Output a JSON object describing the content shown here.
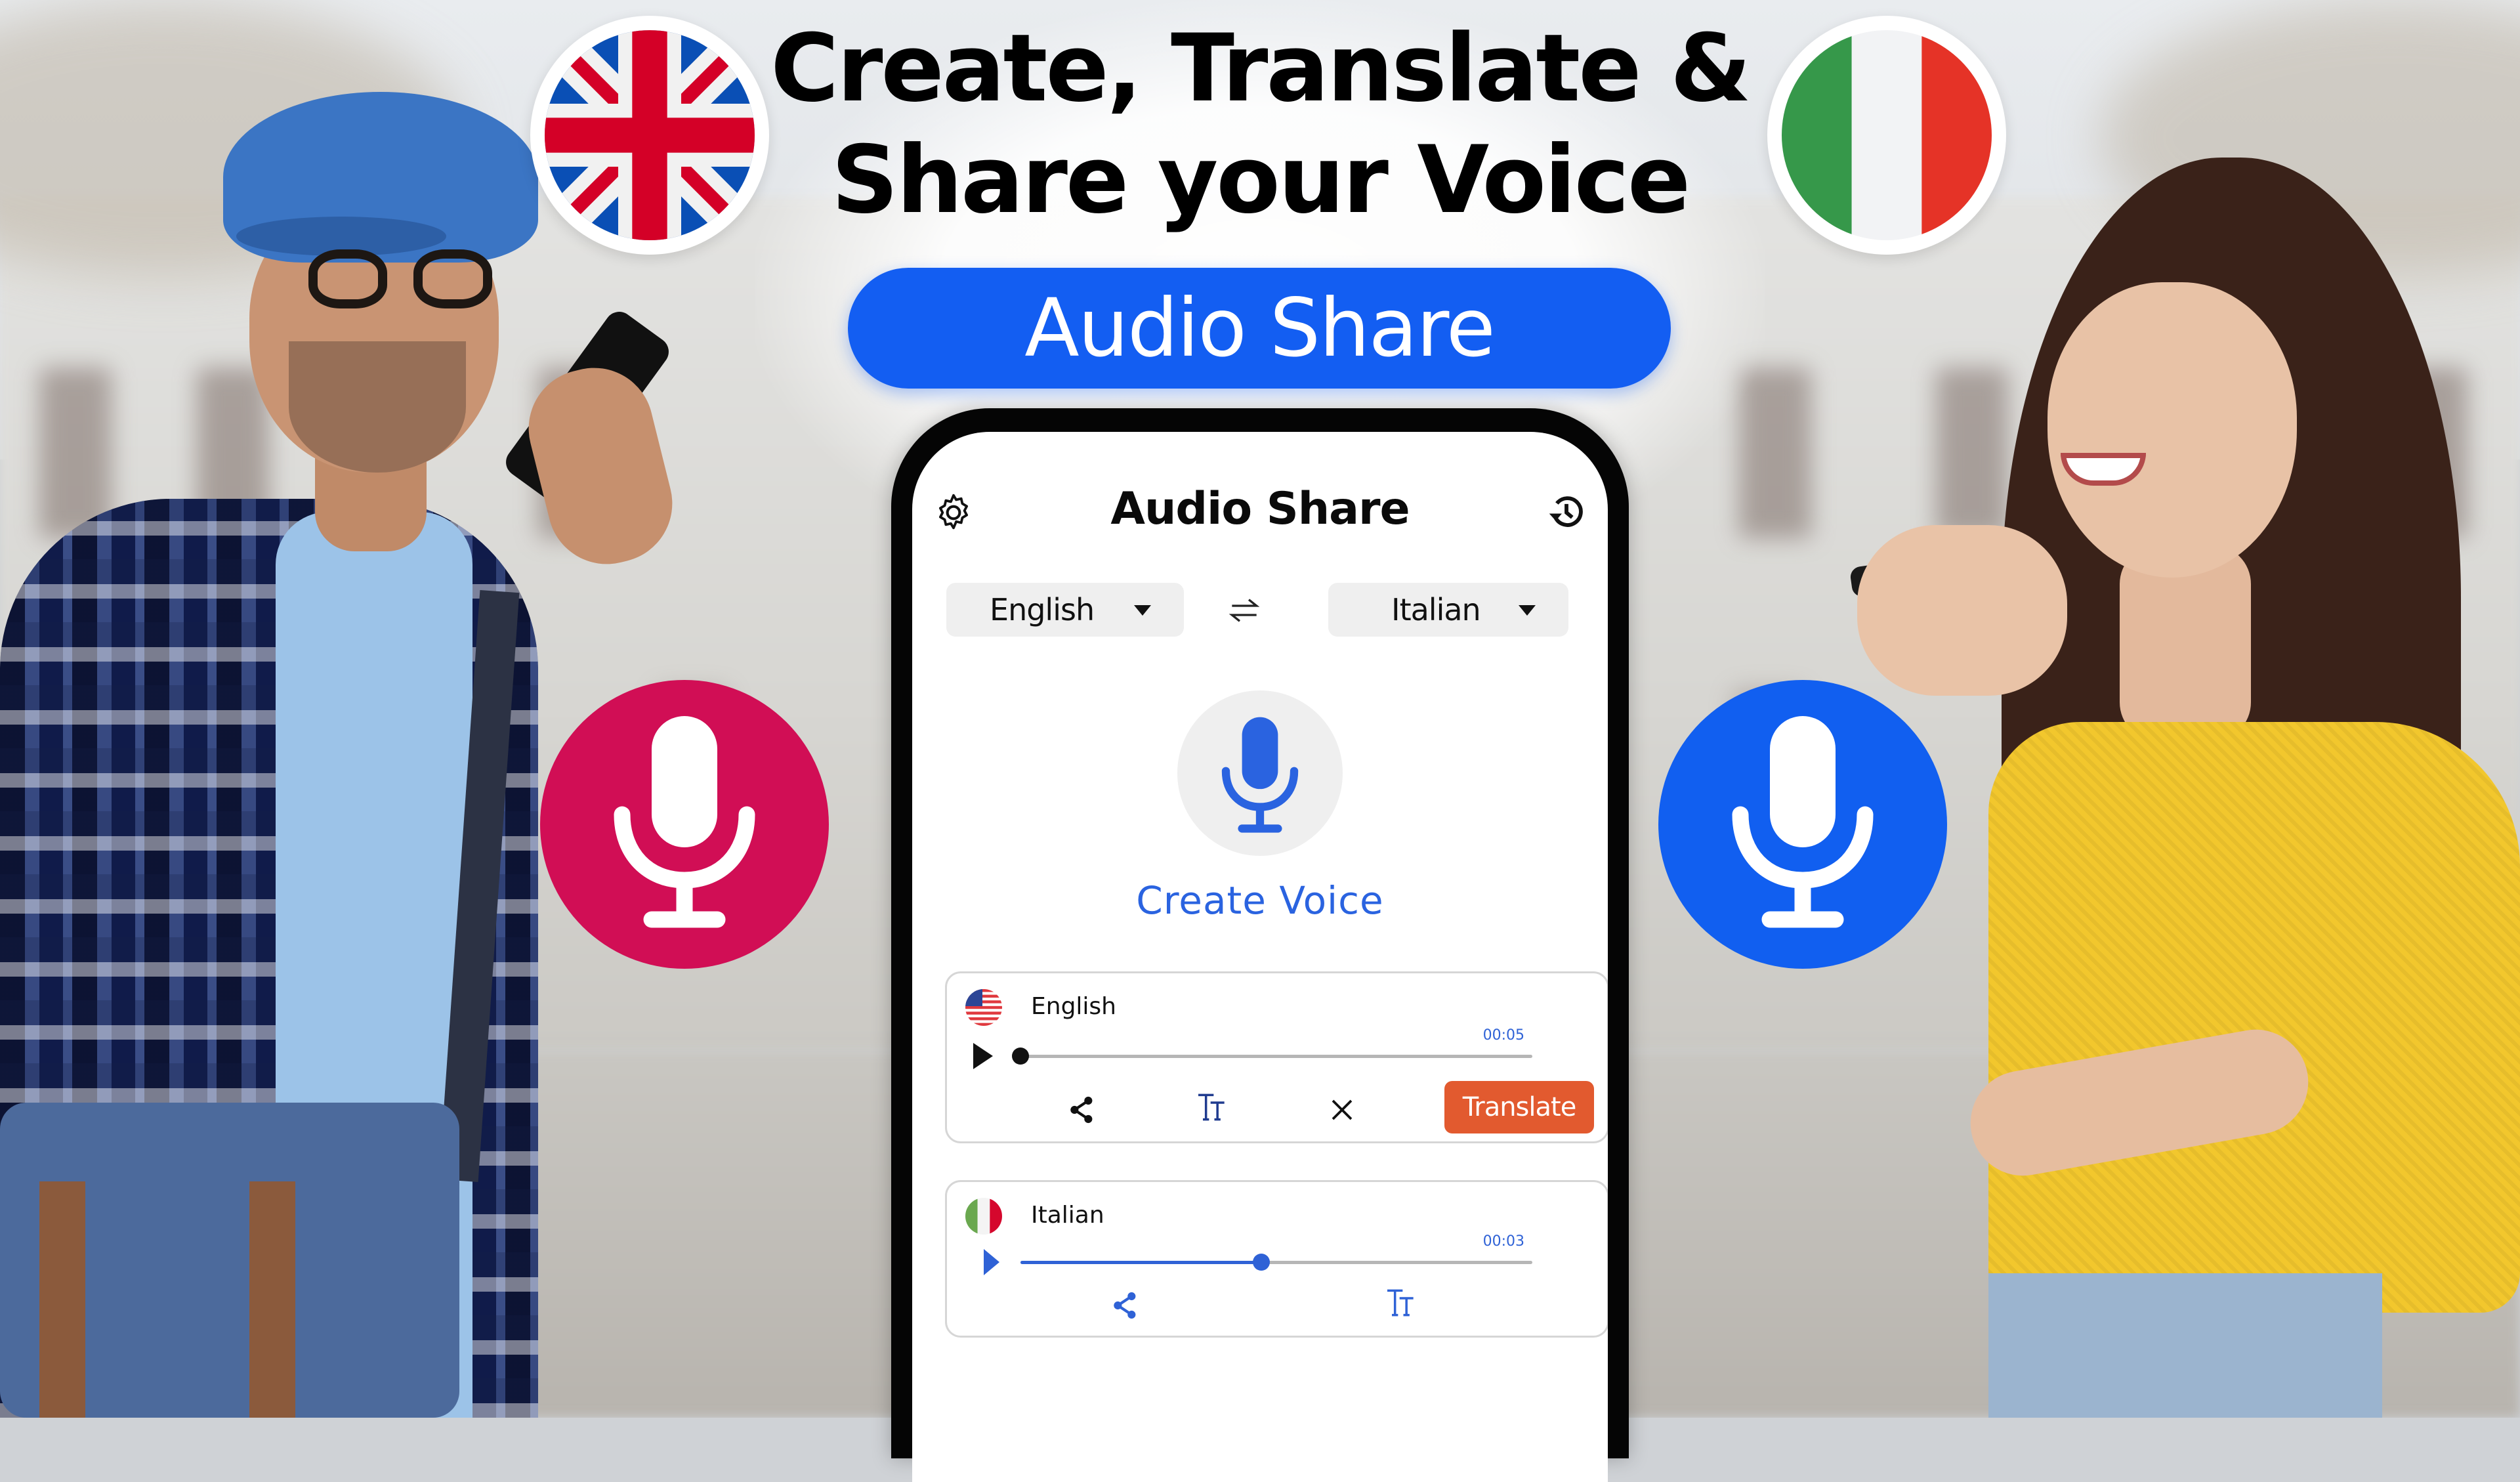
{
  "headline": {
    "line1": "Create, Translate &",
    "line2": "Share your Voice"
  },
  "brand_pill": {
    "label": "Audio Share"
  },
  "flags": {
    "left": "uk-flag-icon",
    "right": "italy-flag-icon"
  },
  "side_mics": {
    "left_color": "#d10e55",
    "right_color": "#115ff0"
  },
  "app": {
    "title": "Audio Share",
    "icons": {
      "settings": "gear-icon",
      "history": "history-icon",
      "swap": "swap-icon"
    },
    "source_language": {
      "selected": "English"
    },
    "target_language": {
      "selected": "Italian"
    },
    "record_label": "Create Voice",
    "accent_color": "#2a63e0",
    "recordings": [
      {
        "language": "English",
        "flag": "us-flag-icon",
        "duration": "00:05",
        "progress": 0.0,
        "actions": [
          "share-icon",
          "text-size-icon",
          "close-icon"
        ],
        "translate_label": "Translate"
      },
      {
        "language": "Italian",
        "flag": "italy-flag-icon",
        "duration": "00:03",
        "progress": 0.47,
        "actions": [
          "share-icon",
          "text-size-icon"
        ]
      }
    ],
    "translate_color": "#e25a2f"
  }
}
